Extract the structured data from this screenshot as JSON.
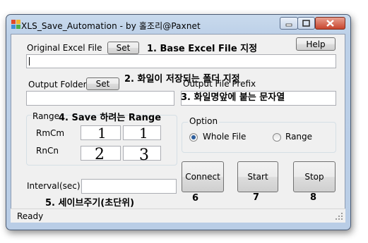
{
  "window": {
    "title": "XLS_Save_Automation - by 홀조리@Paxnet"
  },
  "original": {
    "label": "Original Excel File",
    "set_label": "Set",
    "path_value": "",
    "help_label": "Help"
  },
  "output_folder": {
    "label": "Output Folder",
    "set_label": "Set",
    "value": ""
  },
  "output_prefix": {
    "label": "Output File Prefix",
    "value": ""
  },
  "range": {
    "group_label": "Range",
    "rows": [
      {
        "label": "RmCm",
        "values": [
          "1",
          "1"
        ]
      },
      {
        "label": "RnCn",
        "values": [
          "2",
          "3"
        ]
      }
    ]
  },
  "option": {
    "group_label": "Option",
    "choices": [
      {
        "label": "Whole File",
        "selected": true
      },
      {
        "label": "Range",
        "selected": false
      }
    ]
  },
  "interval": {
    "label": "Interval(sec)",
    "value": ""
  },
  "actions": {
    "connect_label": "Connect",
    "start_label": "Start",
    "stop_label": "Stop"
  },
  "status": {
    "text": "Ready"
  },
  "annotations": {
    "a1": "1. Base Excel File 지정",
    "a2": "2. 화일이 저장되는 폴더 지정",
    "a3": "3. 화일명앞에 붙는 문자열",
    "a4": "4.  Save 하려는 Range",
    "a5": "5.  세이브주기(초단위)",
    "a6": "6",
    "a7": "7",
    "a8": "8"
  }
}
